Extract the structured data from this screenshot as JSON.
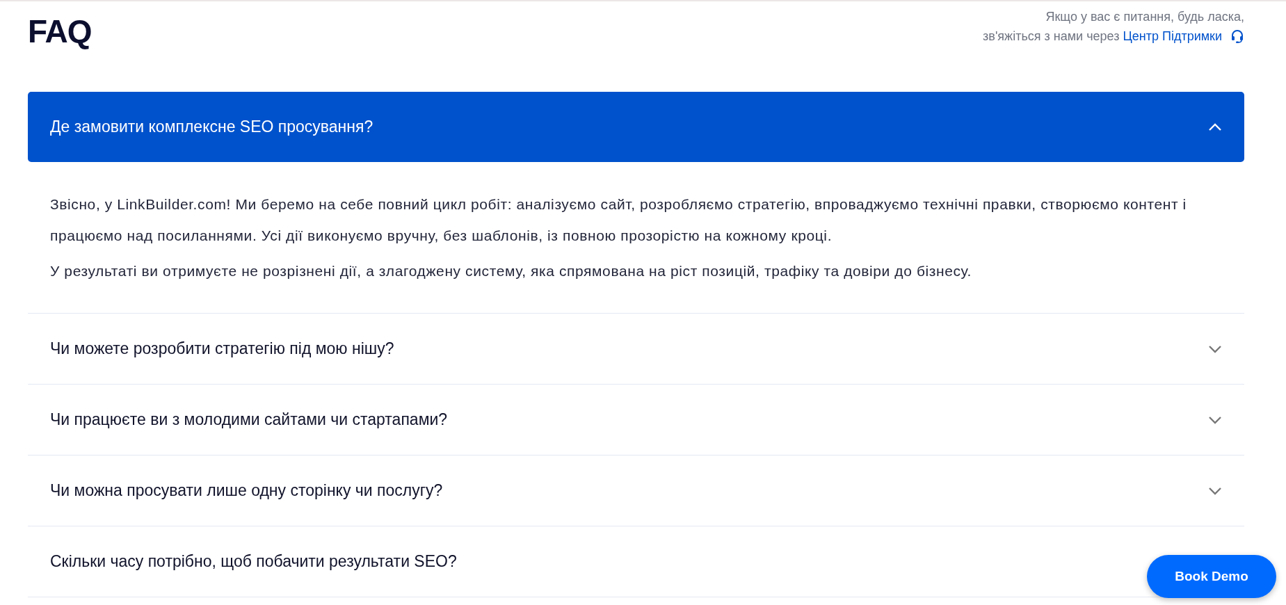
{
  "title": "FAQ",
  "support": {
    "line_1": "Якщо у вас є питання, будь ласка,",
    "line_2": "зв'яжіться з нами через",
    "link": "Центр Підтримки"
  },
  "faq_items": [
    {
      "question": "Де замовити комплексне SEO просування?",
      "expanded": true,
      "answer": [
        "Звісно, у LinkBuilder.com! Ми беремо на себе повний цикл робіт: аналізуємо сайт, розробляємо стратегію, впроваджуємо технічні правки, створюємо контент і працюємо над посиланнями. Усі дії виконуємо вручну, без шаблонів, із повною прозорістю на кожному кроці.",
        "У результаті ви отримуєте не розрізнені дії, а злагоджену систему, яка спрямована на ріст позицій, трафіку та довіри до бізнесу."
      ]
    },
    {
      "question": "Чи можете розробити стратегію під мою нішу?",
      "expanded": false
    },
    {
      "question": "Чи працюєте ви з молодими сайтами чи стартапами?",
      "expanded": false
    },
    {
      "question": "Чи можна просувати лише одну сторінку чи послугу?",
      "expanded": false
    },
    {
      "question": "Скільки часу потрібно, щоб побачити результати SEO?",
      "expanded": false
    }
  ],
  "book_demo": "Book Demo"
}
